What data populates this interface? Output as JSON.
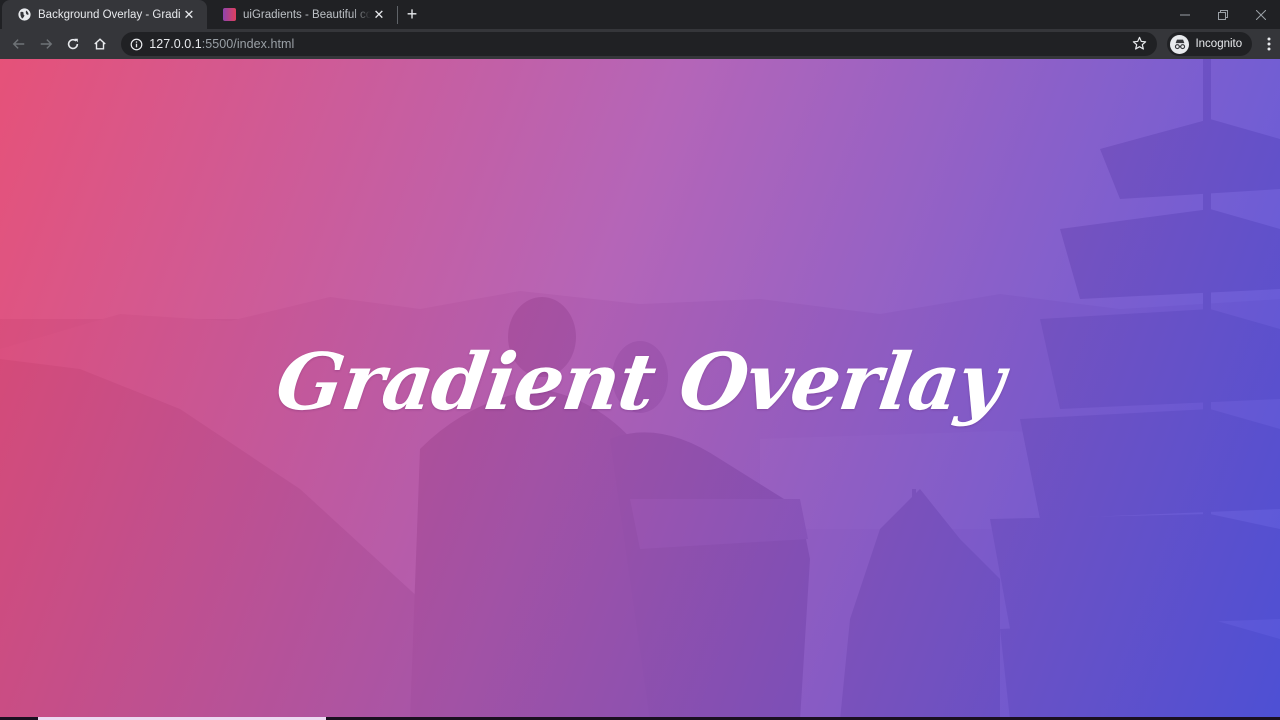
{
  "browser": {
    "tabs": [
      {
        "title": "Background Overlay - Gradient",
        "favicon": "globe-icon",
        "active": true
      },
      {
        "title": "uiGradients - Beautiful colored gradients",
        "favicon": "uigradients-favicon",
        "active": false
      }
    ],
    "new_tab_label": "+",
    "window_controls": {
      "minimize": "—",
      "maximize": "❐",
      "close": "✕"
    },
    "address_bar": {
      "host": "127.0.0.1",
      "rest": ":5500/index.html"
    },
    "incognito_label": "Incognito"
  },
  "page": {
    "hero_title": "Gradient Overlay",
    "overlay_colors": {
      "start": "#ec466e",
      "mid": "#b455b4",
      "end": "#4b50e1"
    }
  },
  "video_progress": {
    "fraction": 0.255,
    "start_fraction": 0.03
  }
}
